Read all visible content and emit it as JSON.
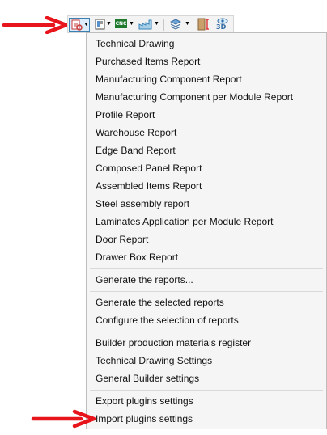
{
  "toolbar": {
    "buttons": [
      {
        "name": "report",
        "icon": "report-icon",
        "has_dropdown": true
      },
      {
        "name": "layout",
        "icon": "layout-icon",
        "has_dropdown": true
      },
      {
        "name": "cnc",
        "icon": "cnc-icon",
        "label": "CNC",
        "has_dropdown": true
      },
      {
        "name": "chart",
        "icon": "factory-chart-icon",
        "has_dropdown": true
      },
      {
        "name": "layers",
        "icon": "layers-icon",
        "has_dropdown": true
      },
      {
        "name": "panel",
        "icon": "panel-height-icon",
        "has_dropdown": false
      },
      {
        "name": "view3d",
        "icon": "eye-3d-icon",
        "label": "3D",
        "has_dropdown": false
      }
    ]
  },
  "menu": {
    "group1": [
      "Technical Drawing",
      "Purchased Items Report",
      "Manufacturing Component Report",
      "Manufacturing Component per Module Report",
      "Profile Report",
      "Warehouse Report",
      "Edge Band Report",
      "Composed Panel Report",
      "Assembled Items Report",
      "Steel assembly report",
      "Laminates Application per Module Report",
      "Door Report",
      "Drawer Box Report"
    ],
    "group2": [
      "Generate the reports..."
    ],
    "group3": [
      "Generate the selected reports",
      "Configure the selection of reports"
    ],
    "group4": [
      "Builder production materials register",
      "Technical Drawing Settings",
      "General Builder settings"
    ],
    "group5": [
      "Export plugins settings",
      "Import plugins settings"
    ]
  },
  "colors": {
    "annotation_arrow": "#e8141b",
    "menu_background": "#f5f5f5",
    "toolbar_highlight": "#dcecfc"
  }
}
